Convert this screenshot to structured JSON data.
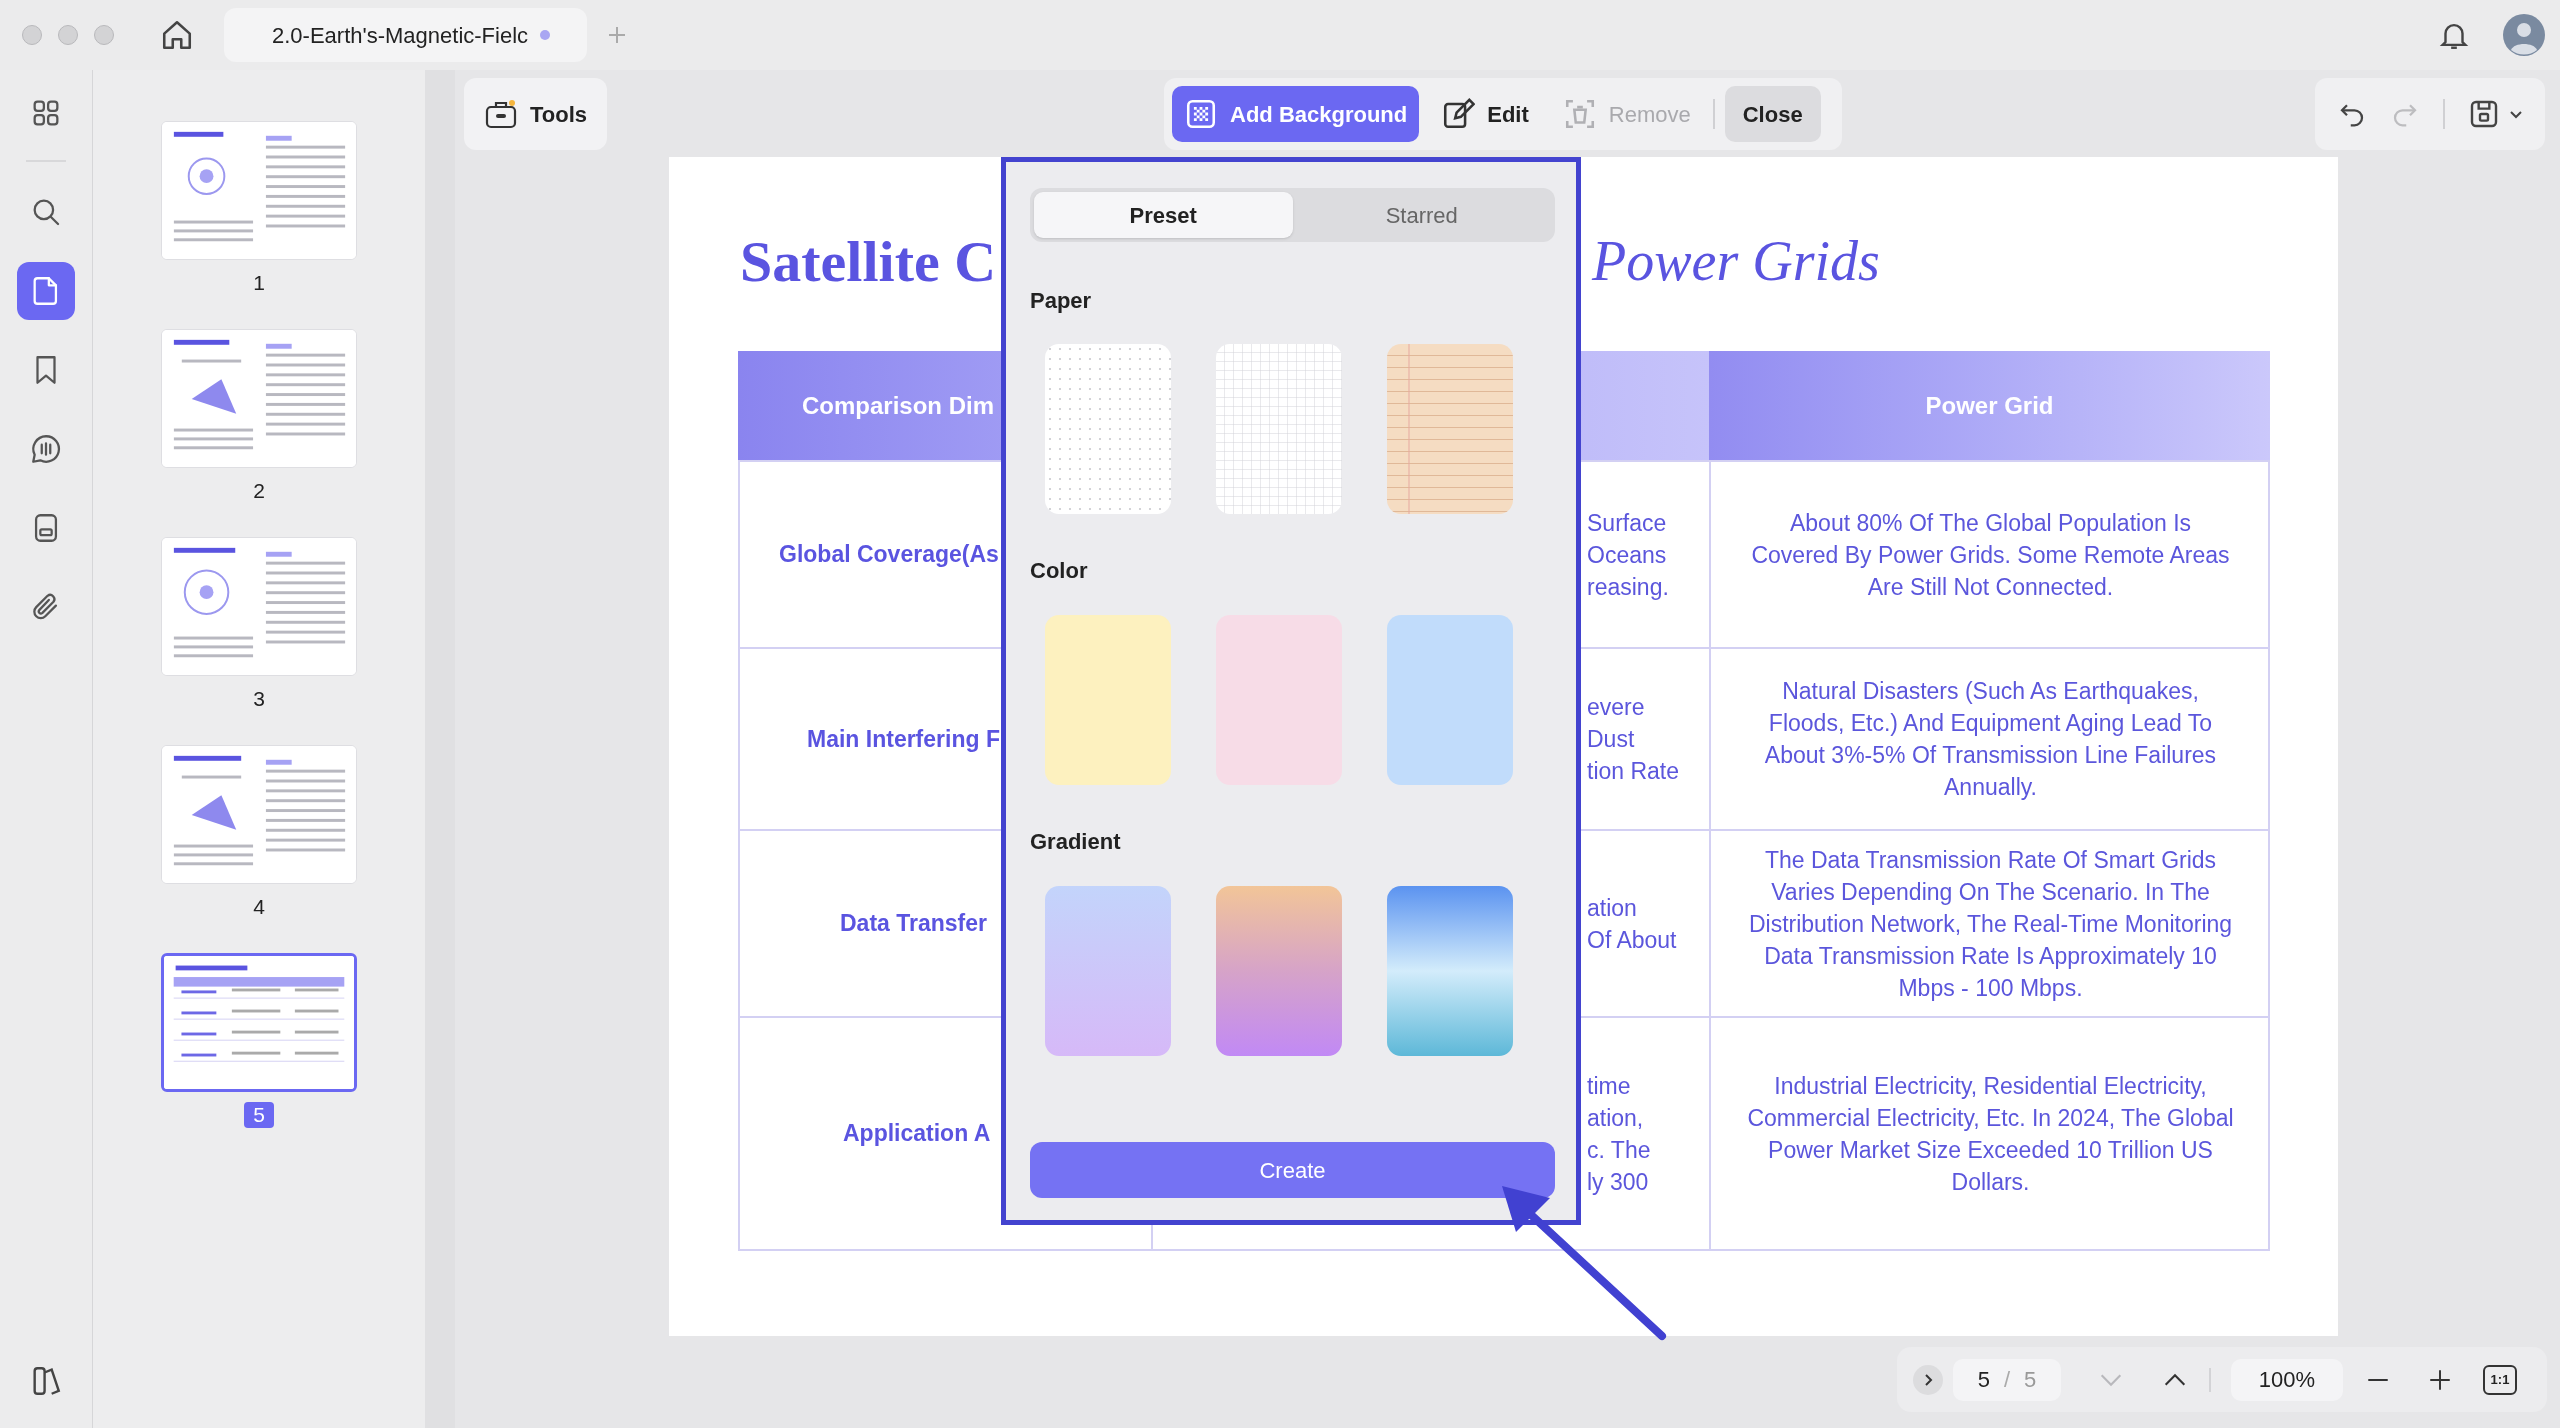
{
  "tab": {
    "title": "2.0-Earth's-Magnetic-Fielc",
    "unsaved": true
  },
  "rail": [
    {
      "selected": false
    },
    {
      "selected": false
    },
    {
      "selected": true
    },
    {
      "selected": false
    },
    {
      "selected": false
    },
    {
      "selected": false
    },
    {
      "selected": false
    }
  ],
  "thumbnails": [
    {
      "label": "1",
      "selected": false
    },
    {
      "label": "2",
      "selected": false
    },
    {
      "label": "3",
      "selected": false
    },
    {
      "label": "4",
      "selected": false
    },
    {
      "label": "5",
      "selected": true
    }
  ],
  "toolbar": {
    "tools": "Tools",
    "actions": [
      {
        "label": "Add Background",
        "kind": "tool",
        "selected": true,
        "disabled": false
      },
      {
        "label": "Edit",
        "kind": "tool",
        "selected": false,
        "disabled": false
      },
      {
        "label": "Remove",
        "kind": "tool",
        "selected": false,
        "disabled": true
      },
      {
        "label": "Close",
        "kind": "close",
        "selected": false,
        "disabled": false
      }
    ],
    "redo_disabled": true
  },
  "document": {
    "title_parts": [
      {
        "text": "Satellite C",
        "italic": false
      },
      {
        "text": "Power Grids",
        "italic": true
      }
    ],
    "table": {
      "column_1": "Comparison Dim",
      "column_3": "Power Grid",
      "rows": [
        {
          "column_1": "Global Coverage(As",
          "column_2": [
            "Surface",
            "Oceans",
            "reasing."
          ],
          "column_3": "About 80% Of The Global Population Is Covered By Power Grids. Some Remote Areas Are Still Not Connected."
        },
        {
          "column_1": "Main Interfering F",
          "column_2": [
            "evere",
            "Dust",
            "tion Rate"
          ],
          "column_3": "Natural Disasters (Such As Earthquakes, Floods, Etc.) And Equipment Aging Lead To About 3%-5% Of Transmission Line Failures Annually."
        },
        {
          "column_1": "Data Transfer",
          "column_2": [
            "ation",
            "Of About"
          ],
          "column_3": "The Data Transmission Rate Of Smart Grids Varies Depending On The Scenario. In The Distribution Network, The Real-Time Monitoring Data Transmission Rate Is Approximately 10 Mbps - 100 Mbps."
        },
        {
          "column_1": "Application A",
          "column_2": [
            "time",
            "ation,",
            "c. The",
            "ly 300"
          ],
          "column_3": "Industrial Electricity, Residential Electricity, Commercial Electricity, Etc. In 2024, The Global Power Market Size Exceeded 10 Trillion US Dollars."
        }
      ]
    }
  },
  "background_panel": {
    "tabs": [
      {
        "label": "Preset",
        "selected": true
      },
      {
        "label": "Starred",
        "selected": false
      }
    ],
    "sections": [
      {
        "title": "Paper",
        "swatches": [
          {
            "kind": "dots",
            "color": "#ffffff"
          },
          {
            "kind": "grid",
            "color": "#ffffff"
          },
          {
            "kind": "lined",
            "color": "#f5dcc2"
          }
        ]
      },
      {
        "title": "Color",
        "swatches": [
          {
            "kind": "solid",
            "color": "#fdf1bf"
          },
          {
            "kind": "solid",
            "color": "#f7dce7"
          },
          {
            "kind": "solid",
            "color": "#c1dcfb"
          }
        ]
      },
      {
        "title": "Gradient",
        "swatches": [
          {
            "kind": "gradient",
            "stops": [
              {
                "color": "#c3d4fb"
              },
              {
                "color": "#d6b9f8"
              }
            ]
          },
          {
            "kind": "gradient",
            "stops": [
              {
                "color": "#f2c598"
              },
              {
                "color": "#d6a3c8"
              },
              {
                "color": "#c189f5"
              }
            ]
          },
          {
            "kind": "gradient",
            "stops": [
              {
                "color": "#5b93f0"
              },
              {
                "color": "#d3ecfb"
              },
              {
                "color": "#5db8d8"
              }
            ]
          }
        ]
      }
    ],
    "create_button": "Create"
  },
  "page_nav": {
    "current": "5",
    "separator": "/",
    "total": "5",
    "next_disabled": true,
    "zoom": "100%",
    "actual_size": "1:1"
  }
}
